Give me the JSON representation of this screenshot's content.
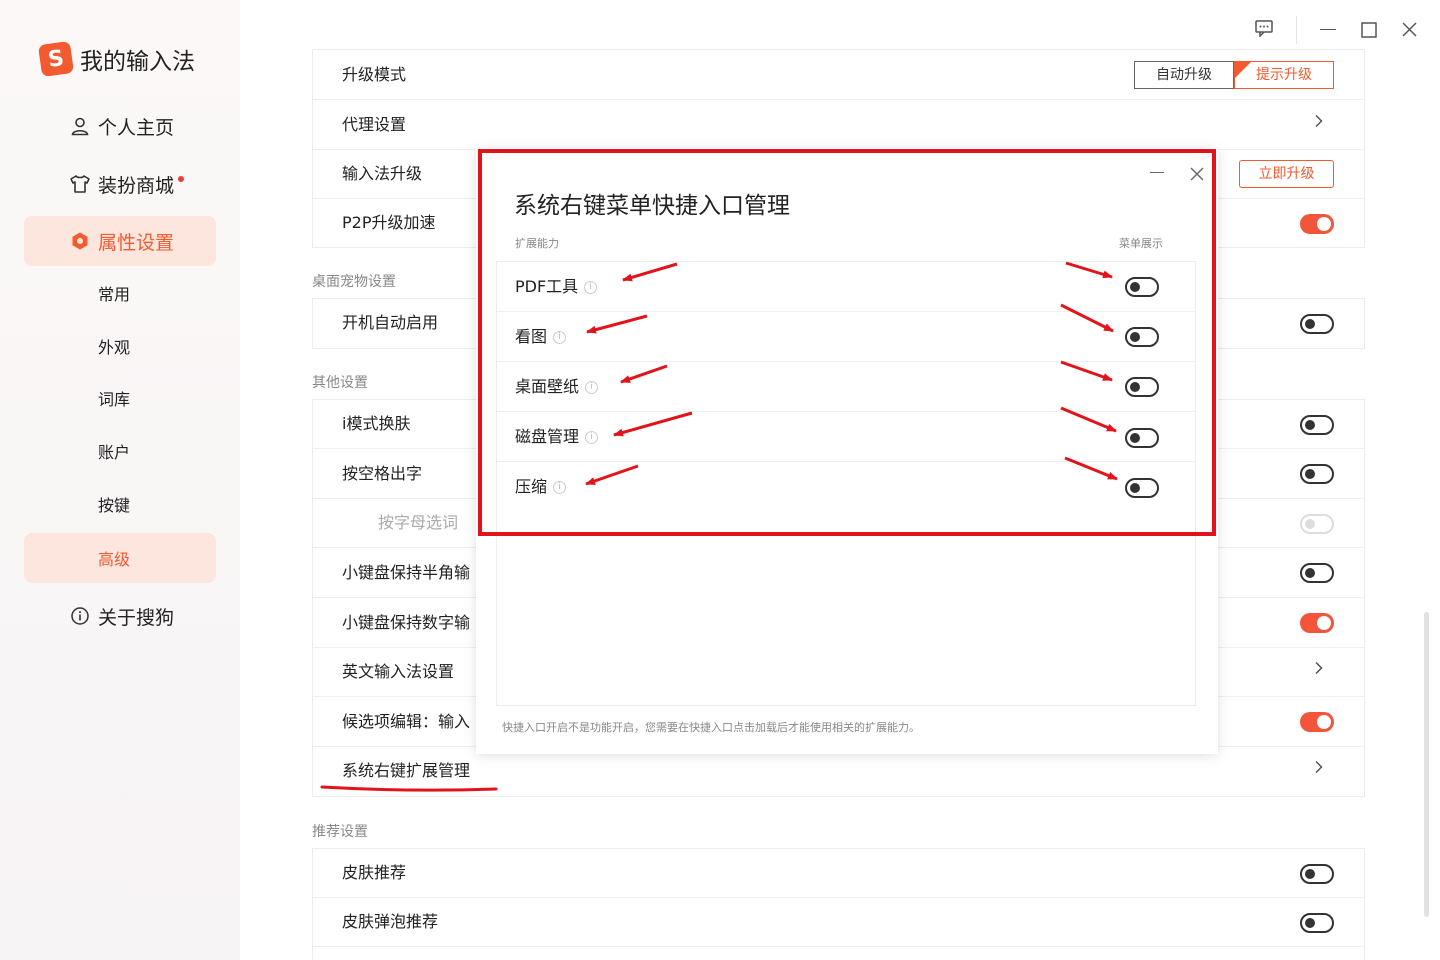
{
  "app": {
    "logo_glyph": "S",
    "title": "我的输入法"
  },
  "sidebar": {
    "main_items": [
      {
        "label": "个人主页",
        "icon": "user-icon"
      },
      {
        "label": "装扮商城",
        "icon": "shirt-icon",
        "dot": true
      },
      {
        "label": "属性设置",
        "icon": "settings-hex-icon",
        "active": true
      }
    ],
    "sub_items": [
      "常用",
      "外观",
      "词库",
      "账户",
      "按键",
      "高级"
    ],
    "about": {
      "label": "关于搜狗",
      "icon": "info-icon"
    }
  },
  "window_controls": {
    "feedback_icon": "feedback-icon",
    "minimize_icon": "minimize-icon",
    "maximize_icon": "maximize-icon",
    "close_icon": "close-icon"
  },
  "upgrade": {
    "mode_label": "升级模式",
    "mode_options": [
      "自动升级",
      "提示升级"
    ],
    "selected_mode": "提示升级",
    "proxy_label": "代理设置",
    "ime_upgrade_label": "输入法升级",
    "upgrade_now": "立即升级",
    "p2p_label": "P2P升级加速"
  },
  "sections": {
    "pet_title": "桌面宠物设置",
    "pet_autostart": "开机自动启用",
    "other_title": "其他设置",
    "other_rows": [
      "i模式换肤",
      "按空格出字",
      "按字母选词",
      "小键盘保持半角输",
      "小键盘保持数字输",
      "英文输入法设置",
      "候选项编辑：输入",
      "系统右键扩展管理"
    ],
    "recommend_title": "推荐设置",
    "recommend_rows": [
      "皮肤推荐",
      "皮肤弹泡推荐"
    ]
  },
  "dialog": {
    "title": "系统右键菜单快捷入口管理",
    "col_left": "扩展能力",
    "col_right": "菜单展示",
    "items": [
      "PDF工具",
      "看图",
      "桌面壁纸",
      "磁盘管理",
      "压缩"
    ],
    "info_glyph": "i",
    "note": "快捷入口开启不是功能开启，您需要在快捷入口点击加载后才能使用相关的扩展能力。"
  },
  "colors": {
    "accent": "#f25a2f",
    "annotation": "#e3131c"
  }
}
